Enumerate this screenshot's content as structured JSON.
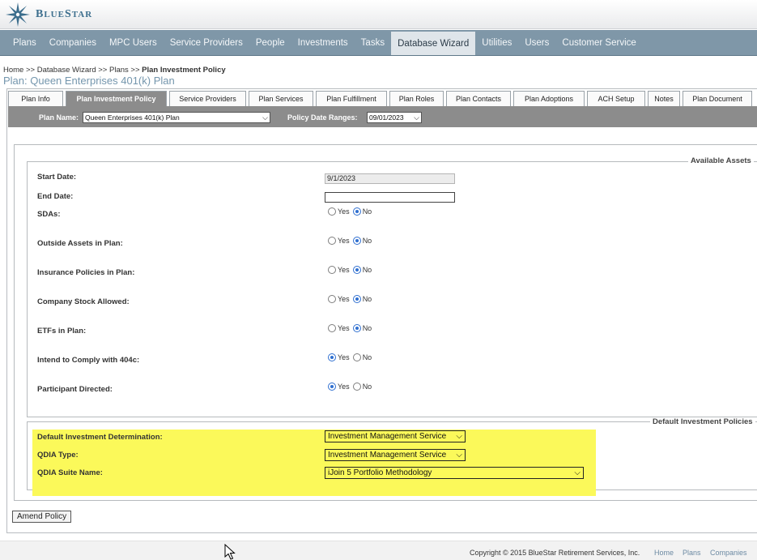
{
  "brand": {
    "name_big": "B",
    "name_small": "LUE",
    "name_big2": "S",
    "name_small2": "TAR",
    "accent": "#3d6f8e"
  },
  "nav": [
    {
      "label": "Plans"
    },
    {
      "label": "Companies"
    },
    {
      "label": "MPC Users"
    },
    {
      "label": "Service Providers"
    },
    {
      "label": "People"
    },
    {
      "label": "Investments"
    },
    {
      "label": "Tasks"
    },
    {
      "label": "Database Wizard",
      "active": true
    },
    {
      "label": "Utilities"
    },
    {
      "label": "Users"
    },
    {
      "label": "Customer Service"
    }
  ],
  "breadcrumb": {
    "home": "Home",
    "sep": ">>",
    "wizard": "Database Wizard",
    "plans": "Plans",
    "current": "Plan Investment Policy"
  },
  "plan_title": "Plan: Queen Enterprises 401(k) Plan",
  "tabs": [
    {
      "label": "Plan Info"
    },
    {
      "label": "Plan Investment Policy",
      "active": true
    },
    {
      "label": "Service Providers"
    },
    {
      "label": "Plan Services"
    },
    {
      "label": "Plan Fulfillment"
    },
    {
      "label": "Plan Roles"
    },
    {
      "label": "Plan Contacts"
    },
    {
      "label": "Plan Adoptions"
    },
    {
      "label": "ACH Setup"
    },
    {
      "label": "Notes"
    },
    {
      "label": "Plan Document"
    }
  ],
  "filters": {
    "plan_name_label": "Plan Name:",
    "plan_name_value": "Queen Enterprises 401(k) Plan",
    "policy_date_label": "Policy Date Ranges:",
    "policy_date_value": "09/01/2023"
  },
  "available_assets": {
    "legend": "Available Assets",
    "start_date_label": "Start Date:",
    "start_date_value": "9/1/2023",
    "end_date_label": "End Date:",
    "end_date_value": "",
    "yes": "Yes",
    "no": "No",
    "questions": [
      {
        "label": "SDAs:",
        "selected": "No"
      },
      {
        "label": "Outside Assets in Plan:",
        "selected": "No"
      },
      {
        "label": "Insurance Policies in Plan:",
        "selected": "No"
      },
      {
        "label": "Company Stock Allowed:",
        "selected": "No"
      },
      {
        "label": "ETFs in Plan:",
        "selected": "No"
      },
      {
        "label": "Intend to Comply with 404c:",
        "selected": "Yes"
      },
      {
        "label": "Participant Directed:",
        "selected": "Yes"
      }
    ]
  },
  "default_policies": {
    "legend": "Default Investment Policies",
    "default_determination_label": "Default Investment Determination:",
    "default_determination_value": "Investment Management Service",
    "qdia_type_label": "QDIA Type:",
    "qdia_type_value": "Investment Management Service",
    "qdia_suite_label": "QDIA Suite Name:",
    "qdia_suite_value": "iJoin 5 Portfolio Methodology",
    "highlight_color": "#fbf95a"
  },
  "amend_button": "Amend Policy",
  "footer": {
    "copyright": "Copyright © 2015 BlueStar Retirement Services, Inc.",
    "links": [
      {
        "label": "Home"
      },
      {
        "label": "Plans"
      },
      {
        "label": "Companies"
      }
    ]
  }
}
